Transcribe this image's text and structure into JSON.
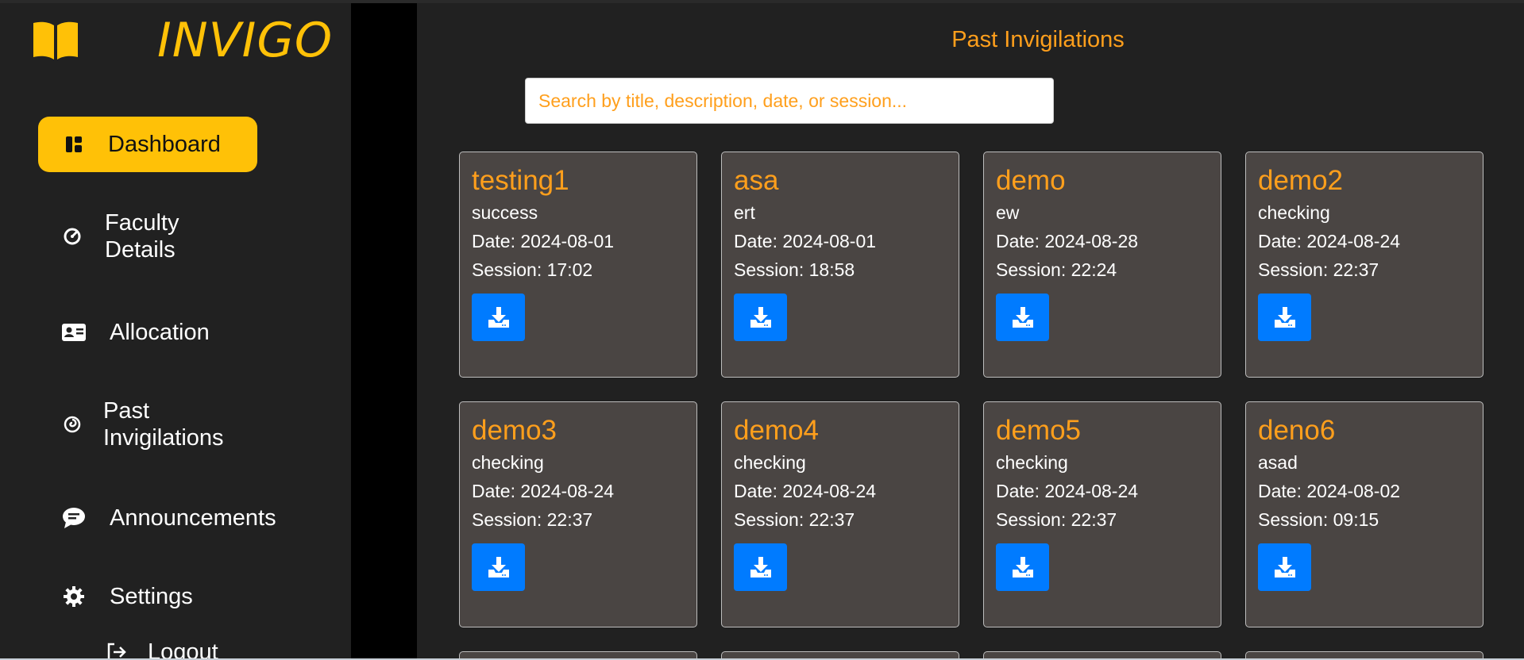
{
  "brand": {
    "name": "INVIGO",
    "color": "#ffc107"
  },
  "sidebar": {
    "items": [
      {
        "label": "Dashboard",
        "icon": "dashboard-icon",
        "active": true
      },
      {
        "label": "Faculty Details",
        "icon": "gauge-icon"
      },
      {
        "label": "Allocation",
        "icon": "id-card-icon"
      },
      {
        "label": "Past Invigilations",
        "icon": "spiral-icon"
      },
      {
        "label": "Announcements",
        "icon": "chat-icon"
      },
      {
        "label": "Settings",
        "icon": "gear-icon"
      },
      {
        "label": "Logout",
        "icon": "logout-icon"
      }
    ]
  },
  "main": {
    "title": "Past Invigilations",
    "search_placeholder": "Search by title, description, date, or session...",
    "date_prefix": "Date: ",
    "session_prefix": "Session: ",
    "cards": [
      {
        "title": "testing1",
        "description": "success",
        "date": "2024-08-01",
        "session": "17:02"
      },
      {
        "title": "asa",
        "description": "ert",
        "date": "2024-08-01",
        "session": "18:58"
      },
      {
        "title": "demo",
        "description": "ew",
        "date": "2024-08-28",
        "session": "22:24"
      },
      {
        "title": "demo2",
        "description": "checking",
        "date": "2024-08-24",
        "session": "22:37"
      },
      {
        "title": "demo3",
        "description": "checking",
        "date": "2024-08-24",
        "session": "22:37"
      },
      {
        "title": "demo4",
        "description": "checking",
        "date": "2024-08-24",
        "session": "22:37"
      },
      {
        "title": "demo5",
        "description": "checking",
        "date": "2024-08-24",
        "session": "22:37"
      },
      {
        "title": "deno6",
        "description": "asad",
        "date": "2024-08-02",
        "session": "09:15"
      }
    ],
    "download_icon": "download-icon"
  },
  "colors": {
    "accent": "#ffc107",
    "title_orange": "#ff9f1c",
    "button_blue": "#007bff"
  }
}
